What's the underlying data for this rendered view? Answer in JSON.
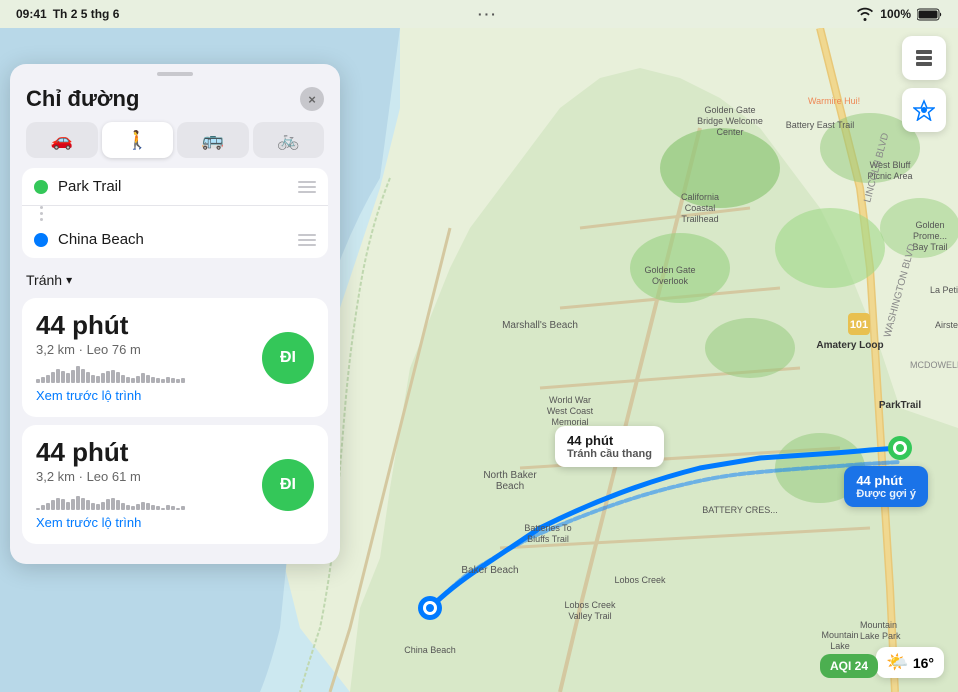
{
  "statusBar": {
    "time": "09:41",
    "day": "Th 2 5 thg 6",
    "wifi": "wifi-icon",
    "battery": "100%",
    "dotsMenu": "···"
  },
  "panel": {
    "dragHandle": true,
    "title": "Chỉ đường",
    "closeLabel": "×",
    "transportTabs": [
      {
        "icon": "🚗",
        "label": "car",
        "active": false
      },
      {
        "icon": "🚶",
        "label": "walk",
        "active": true
      },
      {
        "icon": "🚌",
        "label": "transit",
        "active": false
      },
      {
        "icon": "🚲",
        "label": "bike",
        "active": false
      }
    ],
    "routeFrom": "Park Trail",
    "routeTo": "China Beach",
    "avoidLabel": "Tránh",
    "routes": [
      {
        "time": "44 phút",
        "distance": "3,2 km · Leo 76 m",
        "goLabel": "ĐI",
        "previewLabel": "Xem trước lộ trình",
        "elevBars": [
          3,
          5,
          7,
          9,
          12,
          10,
          8,
          11,
          14,
          12,
          9,
          7,
          6,
          8,
          10,
          11,
          9,
          7,
          5,
          4,
          6,
          8,
          7,
          5,
          4,
          3,
          5,
          4,
          3,
          4
        ]
      },
      {
        "time": "44 phút",
        "distance": "3,2 km · Leo 61 m",
        "goLabel": "ĐI",
        "previewLabel": "Xem trước lộ trình",
        "elevBars": [
          2,
          4,
          6,
          8,
          10,
          9,
          7,
          9,
          12,
          10,
          8,
          6,
          5,
          7,
          9,
          10,
          8,
          6,
          4,
          3,
          5,
          7,
          6,
          4,
          3,
          2,
          4,
          3,
          2,
          3
        ]
      }
    ]
  },
  "map": {
    "callout1": {
      "line1": "44 phút",
      "line2": "Tránh cầu thang"
    },
    "callout2": {
      "line1": "44 phút",
      "line2": "Được gợi ý"
    },
    "weatherTemp": "16°",
    "aqiLabel": "AQI 24"
  }
}
